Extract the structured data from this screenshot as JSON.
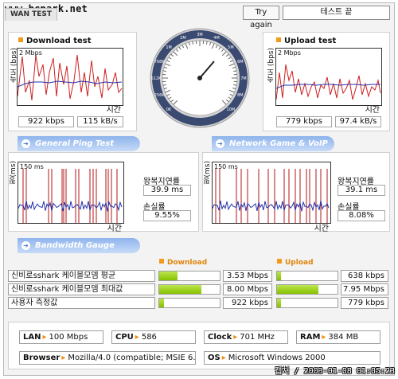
{
  "watermark": "www.bcpark.net",
  "tab": {
    "label": "WAN TEST"
  },
  "header": {
    "try_again": "Try again",
    "status": "테스트 끝"
  },
  "download": {
    "title": "Download test",
    "y_label": "속도 (bps)",
    "scale": "2 Mbps",
    "x_label": "시간",
    "kbps": "922 kbps",
    "kBs": "115 kB/s"
  },
  "upload": {
    "title": "Upload test",
    "y_label": "속도 (bps)",
    "scale": "2 Mbps",
    "x_label": "시간",
    "kbps": "779 kbps",
    "kBs": "97.4 kB/s"
  },
  "gauge": {
    "ticks": [
      "0K",
      "256K",
      "512K",
      "768K",
      "1M",
      "2M",
      "3M",
      "4M",
      "5M",
      "6M",
      "7M",
      "8M",
      "10M"
    ]
  },
  "ping": {
    "band": "General Ping Test",
    "y_label": "핑(ms)",
    "scale": "150 ms",
    "x_label": "시간",
    "latency_label": "왕복지연률",
    "latency": "39.9 ms",
    "loss_label": "손실률",
    "loss": "9.55%"
  },
  "game": {
    "band": "Network Game & VoIP Test",
    "y_label": "핑(ms)",
    "scale": "150 ms",
    "x_label": "시간",
    "latency_label": "왕복지연률",
    "latency": "39.1 ms",
    "loss_label": "손실률",
    "loss": "8.08%"
  },
  "bandwidth": {
    "band": "Bandwidth Gauge",
    "download_title": "Download",
    "upload_title": "Upload",
    "rows": [
      {
        "label": "신비로sshark 케이블모뎀 평균",
        "down": "3.53 Mbps",
        "down_frac": 0.3,
        "up": "638 kbps",
        "up_frac": 0.06
      },
      {
        "label": "신비로sshark 케이블모뎀 최대값",
        "down": "8.00 Mbps",
        "down_frac": 0.7,
        "up": "7.95 Mbps",
        "up_frac": 0.68
      },
      {
        "label": "사용자 측정값",
        "down": "922 kbps",
        "down_frac": 0.08,
        "up": "779 kbps",
        "up_frac": 0.07
      }
    ]
  },
  "system": {
    "lan_label": "LAN",
    "lan": "100 Mbps",
    "cpu_label": "CPU",
    "cpu": "586",
    "clock_label": "Clock",
    "clock": "701 MHz",
    "ram_label": "RAM",
    "ram": "384 MB",
    "browser_label": "Browser",
    "browser": "Mozilla/4.0 (compatible; MSIE 6.0",
    "os_label": "OS",
    "os": "Microsoft Windows 2000"
  },
  "capture": "캡쳐 / 2003-01-08 01:05:23",
  "colors": {
    "accent": "#f39a1e",
    "band": "#8fb4ec",
    "bar": "#9ad314",
    "line_red": "#cc1f1f",
    "line_blue": "#2233aa"
  }
}
